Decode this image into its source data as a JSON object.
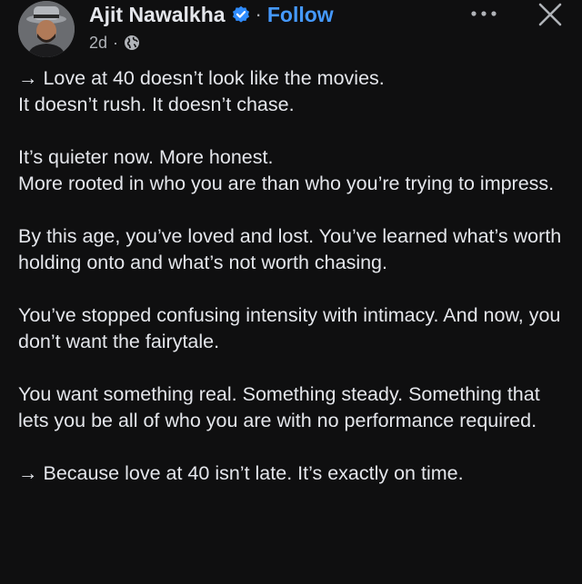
{
  "post": {
    "author": {
      "name": "Ajit Nawalkha",
      "verified_icon": "verified-badge-icon",
      "avatar_icon": "profile-avatar"
    },
    "follow_label": "Follow",
    "separator": "·",
    "time": "2d",
    "audience_icon": "globe-icon",
    "actions": {
      "more_icon": "more-options-icon",
      "close_icon": "close-icon"
    },
    "paragraphs": [
      "→ Love at 40 doesn’t look like the movies.\nIt doesn’t rush. It doesn’t chase.",
      "It’s quieter now. More honest.\nMore rooted in who you are than who you’re trying to impress.",
      "By this age, you’ve loved and lost. You’ve learned what’s worth holding onto and what’s not worth chasing.",
      "You’ve stopped confusing intensity with intimacy. And now, you don’t want the fairytale.",
      "You want something real. Something steady. Something that lets you be all of who you are with no performance required.",
      "→ Because love at 40 isn’t late. It’s exactly on time."
    ]
  },
  "colors": {
    "background": "#0f0f10",
    "text": "#e4e6eb",
    "secondary_text": "#b0b3b8",
    "link": "#4599ff"
  }
}
